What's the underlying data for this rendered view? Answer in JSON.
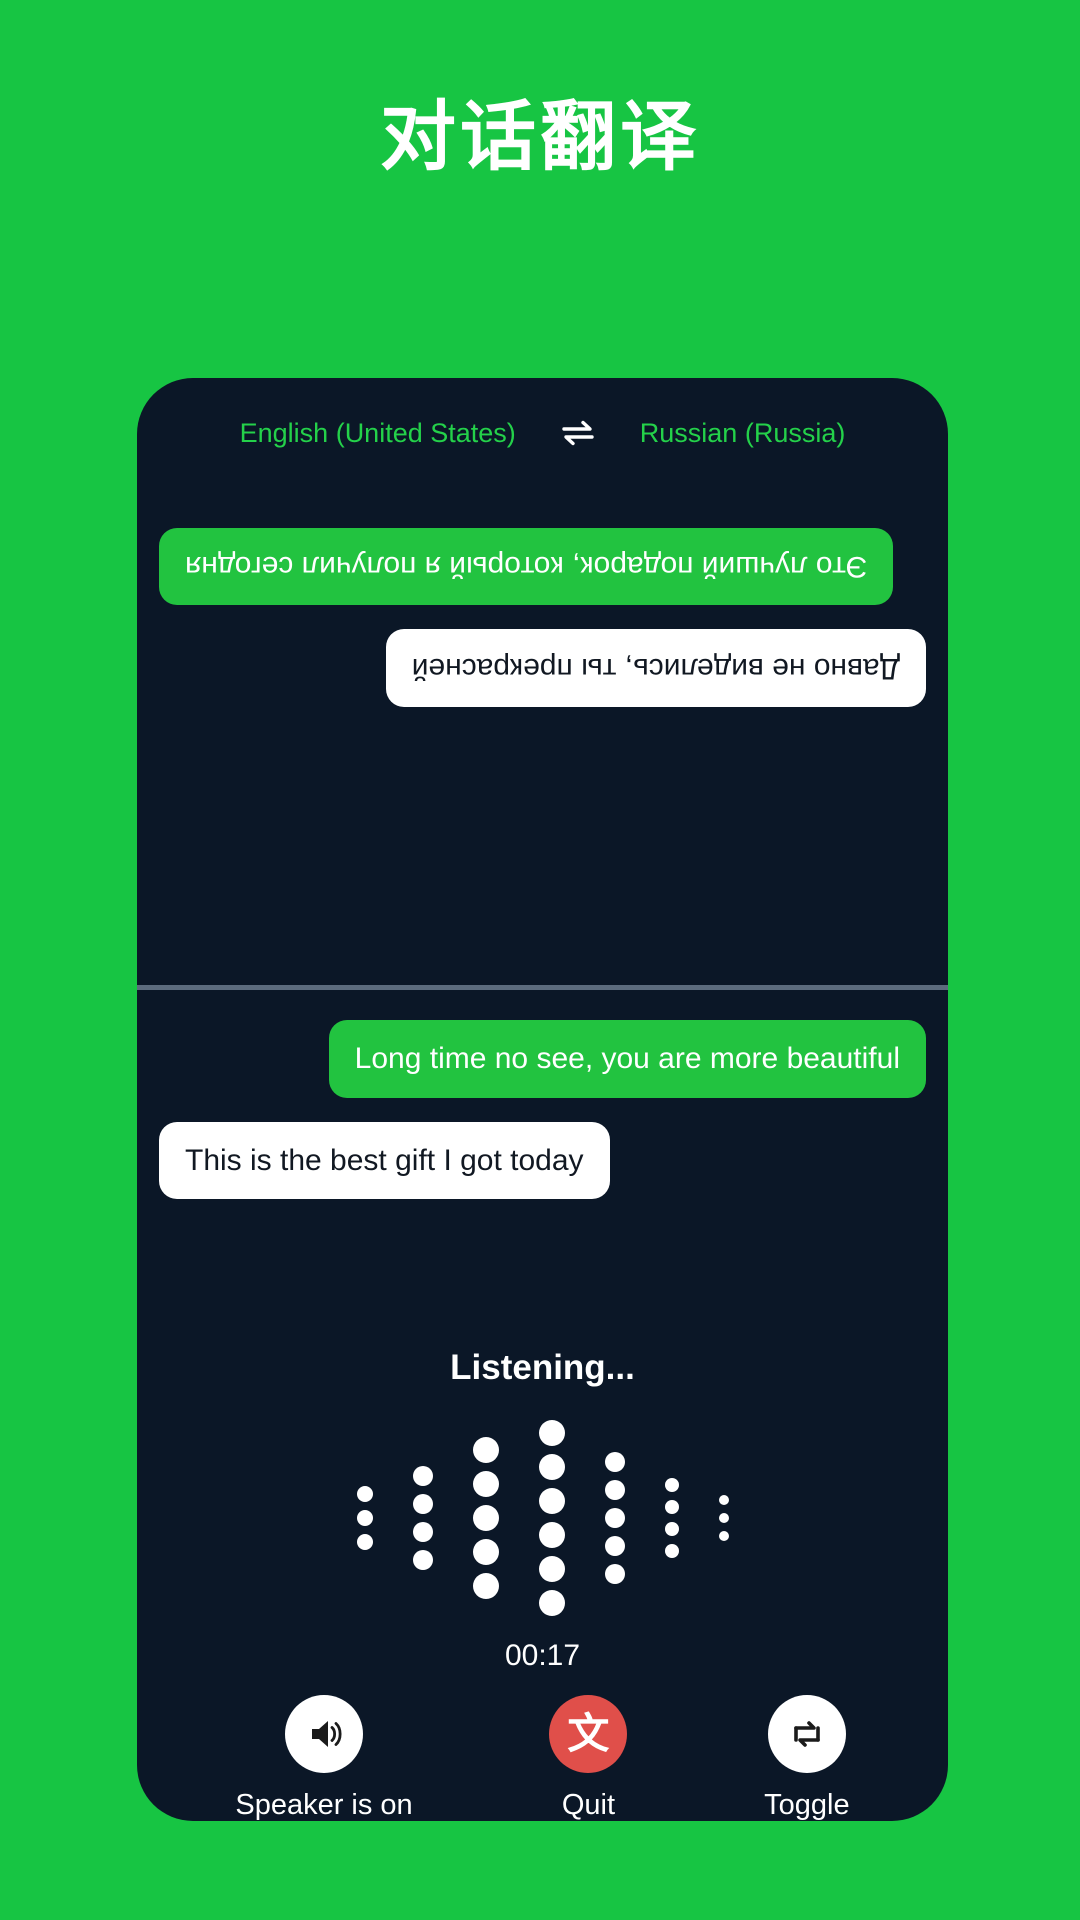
{
  "theme": {
    "background_green": "#17c543",
    "card_dark": "#0b1727",
    "bubble_green": "#22c340",
    "bubble_white": "#ffffff",
    "accent_red": "#e04f4a",
    "lang_text_green": "#24d14a"
  },
  "page": {
    "title": "对话翻译"
  },
  "language_bar": {
    "source_language": "English (United States)",
    "swap_icon": "swap-horizontal-icon",
    "target_language": "Russian (Russia)"
  },
  "conversation": {
    "remote_pane": {
      "rotated": true,
      "messages": [
        {
          "speaker": "remote",
          "align": "right",
          "style": "green",
          "text": "Это лучший подарок, который я получил сегодня"
        },
        {
          "speaker": "remote",
          "align": "left",
          "style": "white",
          "text": "Давно не виделись, ты прекрасней"
        }
      ]
    },
    "local_pane": {
      "rotated": false,
      "messages": [
        {
          "speaker": "local",
          "align": "right",
          "style": "green",
          "text": "Long time no see, you are more beautiful"
        },
        {
          "speaker": "local",
          "align": "left",
          "style": "white",
          "text": "This is the best gift I got today"
        }
      ]
    }
  },
  "listening": {
    "status_text": "Listening...",
    "timer": "00:17",
    "waveform": {
      "columns": [
        {
          "dots": 3,
          "size": 16
        },
        {
          "dots": 4,
          "size": 20
        },
        {
          "dots": 5,
          "size": 26
        },
        {
          "dots": 6,
          "size": 26
        },
        {
          "dots": 5,
          "size": 20
        },
        {
          "dots": 4,
          "size": 14
        },
        {
          "dots": 3,
          "size": 10
        }
      ]
    }
  },
  "controls": [
    {
      "id": "speaker",
      "icon": "speaker-on-icon",
      "label": "Speaker is on",
      "circle": "white"
    },
    {
      "id": "quit",
      "icon": "translate-icon",
      "label": "Quit",
      "circle": "red"
    },
    {
      "id": "toggle",
      "icon": "repeat-swap-icon",
      "label": "Toggle",
      "circle": "white"
    }
  ]
}
